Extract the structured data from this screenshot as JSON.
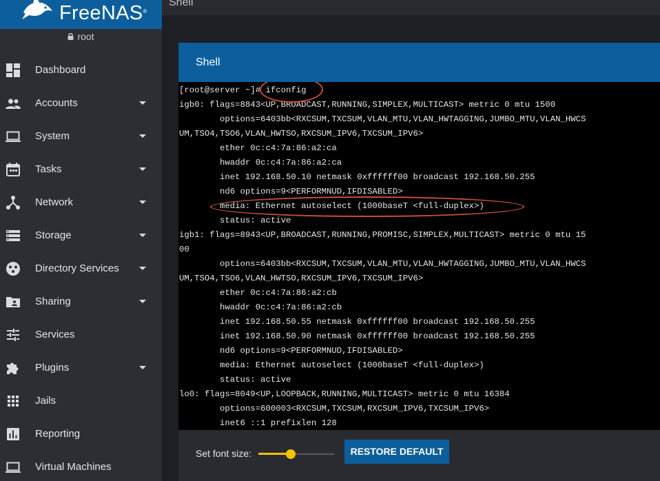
{
  "brand": {
    "name": "FreeNAS",
    "trademark": "®"
  },
  "user": {
    "name": "root",
    "icon": "lock-icon"
  },
  "page": {
    "title": "Shell"
  },
  "sidebar": {
    "items": [
      {
        "label": "Dashboard",
        "icon": "dashboard-icon",
        "expandable": false
      },
      {
        "label": "Accounts",
        "icon": "people-icon",
        "expandable": true
      },
      {
        "label": "System",
        "icon": "laptop-icon",
        "expandable": true
      },
      {
        "label": "Tasks",
        "icon": "calendar-icon",
        "expandable": true
      },
      {
        "label": "Network",
        "icon": "network-icon",
        "expandable": true
      },
      {
        "label": "Storage",
        "icon": "storage-icon",
        "expandable": true
      },
      {
        "label": "Directory Services",
        "icon": "directory-icon",
        "expandable": true
      },
      {
        "label": "Sharing",
        "icon": "shared-folder-icon",
        "expandable": true
      },
      {
        "label": "Services",
        "icon": "tune-icon",
        "expandable": false
      },
      {
        "label": "Plugins",
        "icon": "puzzle-icon",
        "expandable": true
      },
      {
        "label": "Jails",
        "icon": "apps-grid-icon",
        "expandable": false
      },
      {
        "label": "Reporting",
        "icon": "bar-chart-icon",
        "expandable": false
      },
      {
        "label": "Virtual Machines",
        "icon": "computer-icon",
        "expandable": false
      }
    ]
  },
  "shell": {
    "title": "Shell",
    "terminal_lines": [
      "[root@server ~]# ifconfig",
      "igb0: flags=8843<UP,BROADCAST,RUNNING,SIMPLEX,MULTICAST> metric 0 mtu 1500",
      "        options=6403bb<RXCSUM,TXCSUM,VLAN_MTU,VLAN_HWTAGGING,JUMBO_MTU,VLAN_HWCS",
      "UM,TSO4,TSO6,VLAN_HWTSO,RXCSUM_IPV6,TXCSUM_IPV6>",
      "        ether 0c:c4:7a:86:a2:ca",
      "        hwaddr 0c:c4:7a:86:a2:ca",
      "        inet 192.168.50.10 netmask 0xffffff00 broadcast 192.168.50.255",
      "        nd6 options=9<PERFORMNUD,IFDISABLED>",
      "        media: Ethernet autoselect (1000baseT <full-duplex>)",
      "        status: active",
      "igb1: flags=8943<UP,BROADCAST,RUNNING,PROMISC,SIMPLEX,MULTICAST> metric 0 mtu 15",
      "00",
      "        options=6403bb<RXCSUM,TXCSUM,VLAN_MTU,VLAN_HWTAGGING,JUMBO_MTU,VLAN_HWCS",
      "UM,TSO4,TSO6,VLAN_HWTSO,RXCSUM_IPV6,TXCSUM_IPV6>",
      "        ether 0c:c4:7a:86:a2:cb",
      "        hwaddr 0c:c4:7a:86:a2:cb",
      "        inet 192.168.50.55 netmask 0xffffff00 broadcast 192.168.50.255",
      "        inet 192.168.50.90 netmask 0xffffff00 broadcast 192.168.50.255",
      "        nd6 options=9<PERFORMNUD,IFDISABLED>",
      "        media: Ethernet autoselect (1000baseT <full-duplex>)",
      "        status: active",
      "lo0: flags=8049<UP,LOOPBACK,RUNNING,MULTICAST> metric 0 mtu 16384",
      "        options=600003<RXCSUM,TXCSUM,RXCSUM_IPV6,TXCSUM_IPV6>",
      "        inet6 ::1 prefixlen 128"
    ],
    "font_size_label": "Set font size:",
    "font_size_level": 0.4,
    "restore_label": "RESTORE DEFAULT"
  },
  "colors": {
    "brand_blue": "#0c5f9c",
    "sidebar_bg": "#2c2e34",
    "slider_accent": "#f2c200",
    "annotation_red": "#c94f3a",
    "terminal_bg": "#000000"
  }
}
